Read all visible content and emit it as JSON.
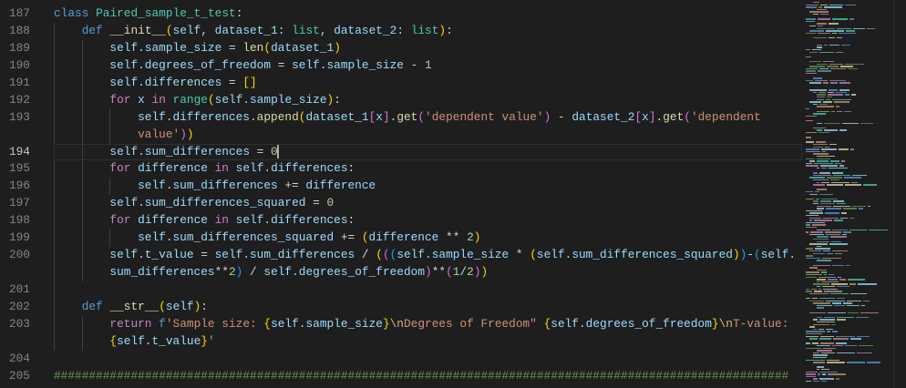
{
  "editor": {
    "language": "python",
    "current_line": 194,
    "lines": [
      {
        "number": 187,
        "indent": 0,
        "rows": [
          [
            [
              "class",
              "k"
            ],
            [
              " ",
              "o"
            ],
            [
              "Paired_sample_t_test",
              "t"
            ],
            [
              ":",
              "o"
            ]
          ]
        ]
      },
      {
        "number": 188,
        "indent": 1,
        "rows": [
          [
            [
              "def",
              "k"
            ],
            [
              " ",
              "o"
            ],
            [
              "__init__",
              "f"
            ],
            [
              "(",
              "b1"
            ],
            [
              "self",
              "v"
            ],
            [
              ", ",
              "o"
            ],
            [
              "dataset_1",
              "v"
            ],
            [
              ": ",
              "o"
            ],
            [
              "list",
              "t"
            ],
            [
              ", ",
              "o"
            ],
            [
              "dataset_2",
              "v"
            ],
            [
              ": ",
              "o"
            ],
            [
              "list",
              "t"
            ],
            [
              ")",
              "b1"
            ],
            [
              ":",
              "o"
            ]
          ]
        ]
      },
      {
        "number": 189,
        "indent": 2,
        "rows": [
          [
            [
              "self.sample_size",
              "v"
            ],
            [
              " = ",
              "o"
            ],
            [
              "len",
              "f"
            ],
            [
              "(",
              "b1"
            ],
            [
              "dataset_1",
              "v"
            ],
            [
              ")",
              "b1"
            ]
          ]
        ]
      },
      {
        "number": 190,
        "indent": 2,
        "rows": [
          [
            [
              "self.degrees_of_freedom",
              "v"
            ],
            [
              " = ",
              "o"
            ],
            [
              "self.sample_size",
              "v"
            ],
            [
              " - ",
              "o"
            ],
            [
              "1",
              "n"
            ]
          ]
        ]
      },
      {
        "number": 191,
        "indent": 2,
        "rows": [
          [
            [
              "self.differences",
              "v"
            ],
            [
              " = ",
              "o"
            ],
            [
              "[]",
              "b1"
            ]
          ]
        ]
      },
      {
        "number": 192,
        "indent": 2,
        "rows": [
          [
            [
              "for",
              "c"
            ],
            [
              " ",
              "o"
            ],
            [
              "x",
              "v"
            ],
            [
              " ",
              "o"
            ],
            [
              "in",
              "c"
            ],
            [
              " ",
              "o"
            ],
            [
              "range",
              "t"
            ],
            [
              "(",
              "b1"
            ],
            [
              "self.sample_size",
              "v"
            ],
            [
              ")",
              "b1"
            ],
            [
              ":",
              "o"
            ]
          ]
        ]
      },
      {
        "number": 193,
        "indent": 3,
        "rows": [
          [
            [
              "self.differences.",
              "v"
            ],
            [
              "append",
              "f"
            ],
            [
              "(",
              "b1"
            ],
            [
              "dataset_1",
              "v"
            ],
            [
              "[",
              "b2"
            ],
            [
              "x",
              "v"
            ],
            [
              "]",
              "b2"
            ],
            [
              ".",
              "o"
            ],
            [
              "get",
              "f"
            ],
            [
              "(",
              "b2"
            ],
            [
              "'dependent value'",
              "s"
            ],
            [
              ")",
              "b2"
            ],
            [
              " - ",
              "o"
            ],
            [
              "dataset_2",
              "v"
            ],
            [
              "[",
              "b2"
            ],
            [
              "x",
              "v"
            ],
            [
              "]",
              "b2"
            ],
            [
              ".",
              "o"
            ],
            [
              "get",
              "f"
            ],
            [
              "(",
              "b2"
            ],
            [
              "'dependent",
              "s"
            ]
          ],
          [
            [
              "value'",
              "s"
            ],
            [
              ")",
              "b2"
            ],
            [
              ")",
              "b1"
            ]
          ]
        ]
      },
      {
        "number": 194,
        "indent": 2,
        "rows": [
          [
            [
              "self.sum_differences",
              "v"
            ],
            [
              " = ",
              "o"
            ],
            [
              "0",
              "n"
            ]
          ]
        ]
      },
      {
        "number": 195,
        "indent": 2,
        "rows": [
          [
            [
              "for",
              "c"
            ],
            [
              " ",
              "o"
            ],
            [
              "difference",
              "v"
            ],
            [
              " ",
              "o"
            ],
            [
              "in",
              "c"
            ],
            [
              " ",
              "o"
            ],
            [
              "self.differences",
              "v"
            ],
            [
              ":",
              "o"
            ]
          ]
        ]
      },
      {
        "number": 196,
        "indent": 3,
        "rows": [
          [
            [
              "self.sum_differences",
              "v"
            ],
            [
              " += ",
              "o"
            ],
            [
              "difference",
              "v"
            ]
          ]
        ]
      },
      {
        "number": 197,
        "indent": 2,
        "rows": [
          [
            [
              "self.sum_differences_squared",
              "v"
            ],
            [
              " = ",
              "o"
            ],
            [
              "0",
              "n"
            ]
          ]
        ]
      },
      {
        "number": 198,
        "indent": 2,
        "rows": [
          [
            [
              "for",
              "c"
            ],
            [
              " ",
              "o"
            ],
            [
              "difference",
              "v"
            ],
            [
              " ",
              "o"
            ],
            [
              "in",
              "c"
            ],
            [
              " ",
              "o"
            ],
            [
              "self.differences",
              "v"
            ],
            [
              ":",
              "o"
            ]
          ]
        ]
      },
      {
        "number": 199,
        "indent": 3,
        "rows": [
          [
            [
              "self.sum_differences_squared",
              "v"
            ],
            [
              " += ",
              "o"
            ],
            [
              "(",
              "b1"
            ],
            [
              "difference",
              "v"
            ],
            [
              " ** ",
              "o"
            ],
            [
              "2",
              "n"
            ],
            [
              ")",
              "b1"
            ]
          ]
        ]
      },
      {
        "number": 200,
        "indent": 2,
        "rows": [
          [
            [
              "self.t_value",
              "v"
            ],
            [
              " = ",
              "o"
            ],
            [
              "self.sum_differences",
              "v"
            ],
            [
              " / ",
              "o"
            ],
            [
              "(",
              "b1"
            ],
            [
              "(",
              "b2"
            ],
            [
              "(",
              "b3"
            ],
            [
              "self.sample_size",
              "v"
            ],
            [
              " * ",
              "o"
            ],
            [
              "(",
              "b1"
            ],
            [
              "self.sum_differences_squared",
              "v"
            ],
            [
              ")",
              "b1"
            ],
            [
              ")",
              "b3"
            ],
            [
              "-",
              "o"
            ],
            [
              "(",
              "b3"
            ],
            [
              "self.",
              "v"
            ]
          ],
          [
            [
              "sum_differences",
              "v"
            ],
            [
              "**",
              "o"
            ],
            [
              "2",
              "n"
            ],
            [
              ")",
              "b3"
            ],
            [
              " / ",
              "o"
            ],
            [
              "self.degrees_of_freedom",
              "v"
            ],
            [
              ")",
              "b2"
            ],
            [
              "**",
              "o"
            ],
            [
              "(",
              "b2"
            ],
            [
              "1",
              "n"
            ],
            [
              "/",
              "o"
            ],
            [
              "2",
              "n"
            ],
            [
              ")",
              "b2"
            ],
            [
              ")",
              "b1"
            ]
          ]
        ]
      },
      {
        "number": 201,
        "indent": 1,
        "rows": [
          []
        ]
      },
      {
        "number": 202,
        "indent": 1,
        "rows": [
          [
            [
              "def",
              "k"
            ],
            [
              " ",
              "o"
            ],
            [
              "__str__",
              "f"
            ],
            [
              "(",
              "b1"
            ],
            [
              "self",
              "v"
            ],
            [
              ")",
              "b1"
            ],
            [
              ":",
              "o"
            ]
          ]
        ]
      },
      {
        "number": 203,
        "indent": 2,
        "rows": [
          [
            [
              "return",
              "c"
            ],
            [
              " ",
              "o"
            ],
            [
              "f",
              "k"
            ],
            [
              "'Sample size: ",
              "s"
            ],
            [
              "{",
              "b1"
            ],
            [
              "self.sample_size",
              "v"
            ],
            [
              "}",
              "b1"
            ],
            [
              "\\n",
              "e"
            ],
            [
              "Degrees of Freedom\" ",
              "s"
            ],
            [
              "{",
              "b1"
            ],
            [
              "self.degrees_of_freedom",
              "v"
            ],
            [
              "}",
              "b1"
            ],
            [
              "\\n",
              "e"
            ],
            [
              "T-value:",
              "s"
            ]
          ],
          [
            [
              "{",
              "b1"
            ],
            [
              "self.t_value",
              "v"
            ],
            [
              "}",
              "b1"
            ],
            [
              "'",
              "s"
            ]
          ]
        ]
      },
      {
        "number": 204,
        "indent": 0,
        "rows": [
          []
        ]
      },
      {
        "number": 205,
        "indent": 0,
        "rows": [
          [
            [
              "#########################################################################################################",
              "cm"
            ]
          ]
        ]
      }
    ]
  }
}
